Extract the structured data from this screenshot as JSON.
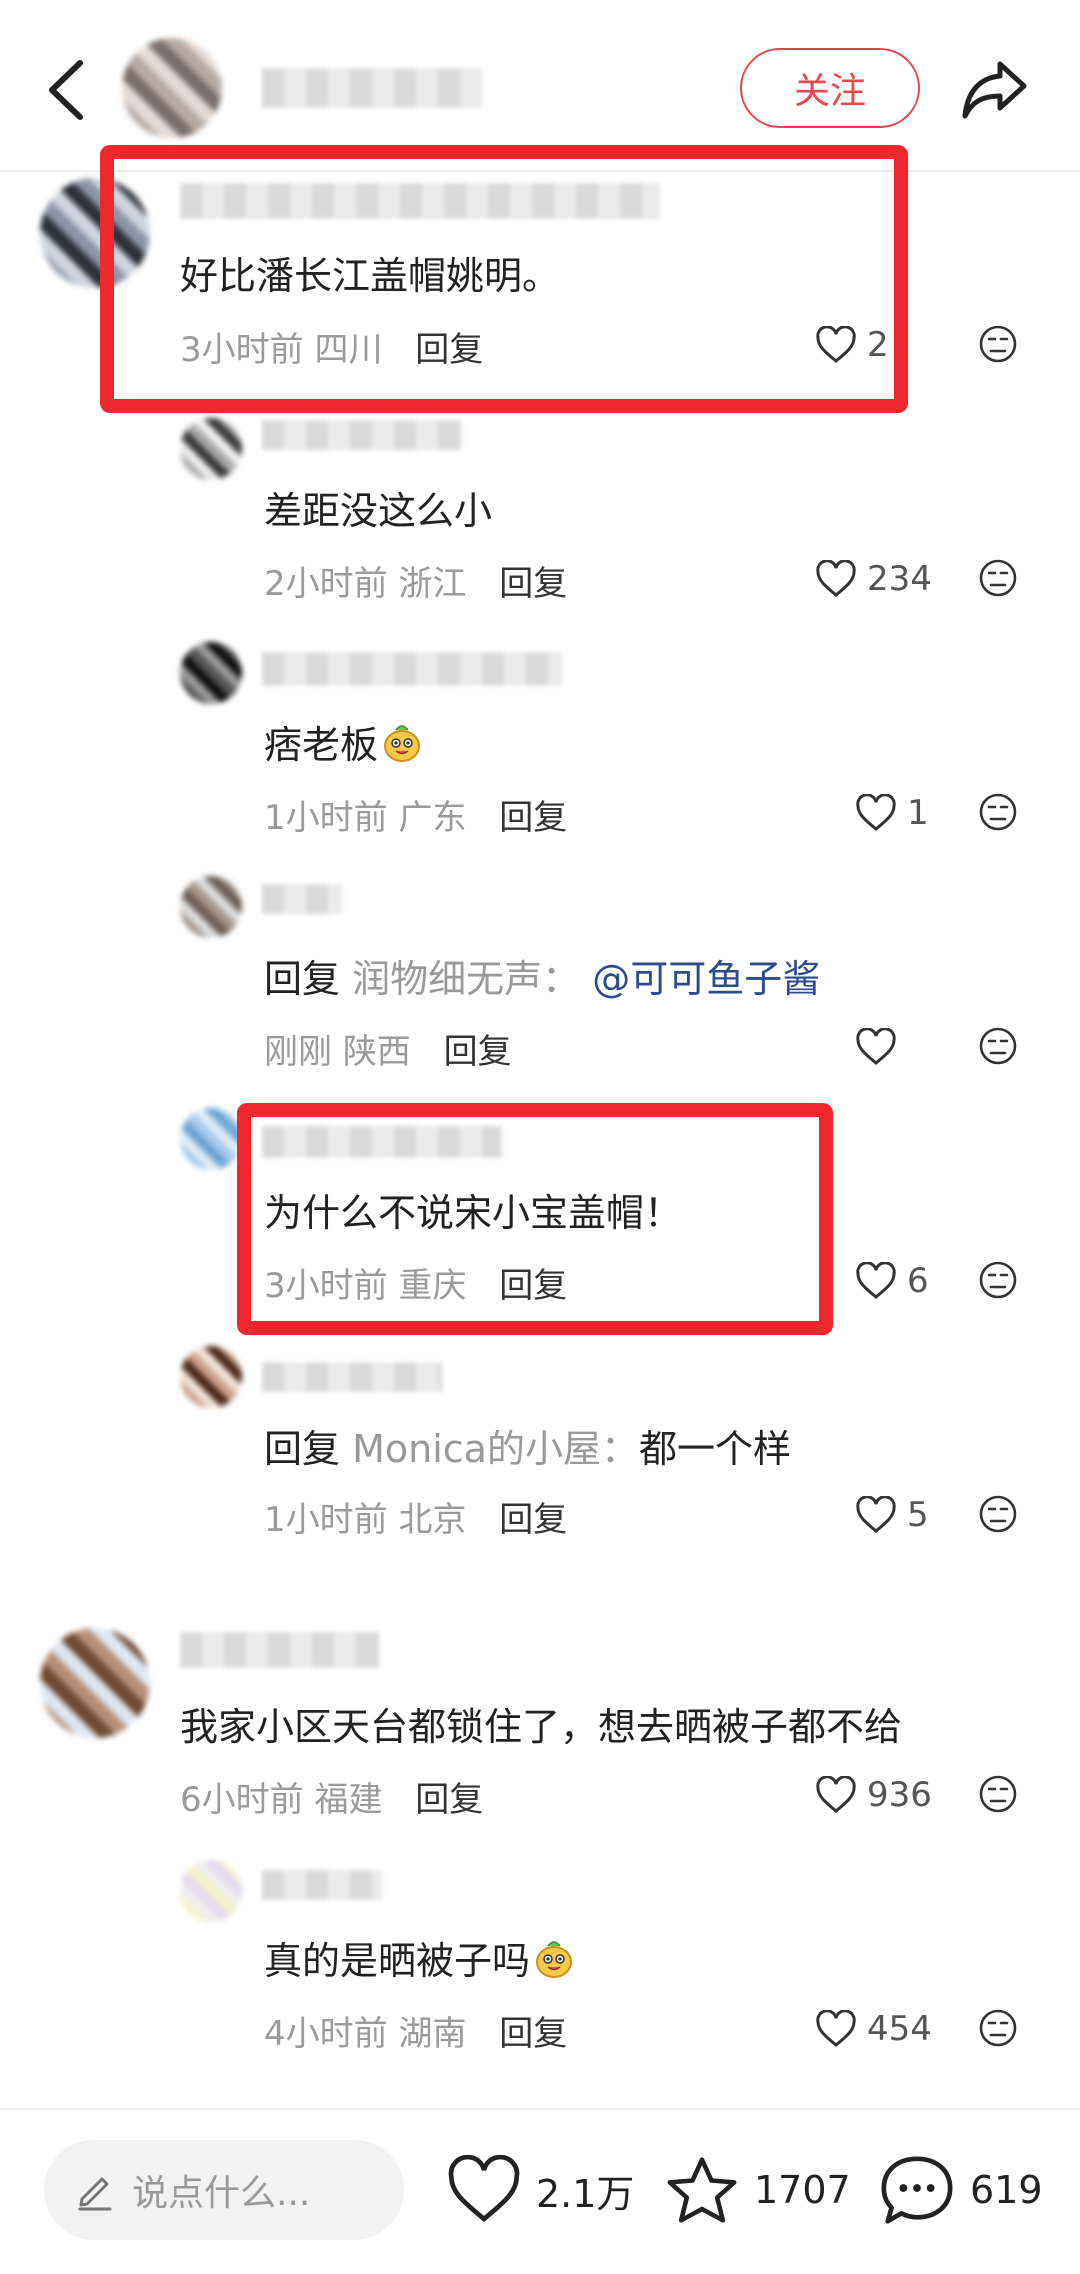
{
  "header": {
    "follow_label": "关注"
  },
  "comments": [
    {
      "text": "好比潘长江盖帽姚明。",
      "time": "3小时前",
      "location": "四川",
      "reply": "回复",
      "likes": "2"
    },
    {
      "text": "差距没这么小",
      "time": "2小时前",
      "location": "浙江",
      "reply": "回复",
      "likes": "234"
    },
    {
      "text": "痞老板",
      "time": "1小时前",
      "location": "广东",
      "reply": "回复",
      "likes": "1"
    },
    {
      "prefix": "回复",
      "reply_to": "润物细无声：",
      "mention": "@可可鱼子酱",
      "time": "刚刚",
      "location": "陕西",
      "reply": "回复",
      "likes": ""
    },
    {
      "text": "为什么不说宋小宝盖帽！",
      "time": "3小时前",
      "location": "重庆",
      "reply": "回复",
      "likes": "6"
    },
    {
      "prefix": "回复",
      "reply_to": "Monica的小屋：",
      "body": "都一个样",
      "time": "1小时前",
      "location": "北京",
      "reply": "回复",
      "likes": "5"
    },
    {
      "text": "我家小区天台都锁住了，想去晒被子都不给",
      "time": "6小时前",
      "location": "福建",
      "reply": "回复",
      "likes": "936"
    },
    {
      "text": "真的是晒被子吗",
      "time": "4小时前",
      "location": "湖南",
      "reply": "回复",
      "likes": "454"
    }
  ],
  "bottom": {
    "input_placeholder": "说点什么...",
    "likes": "2.1万",
    "favorites": "1707",
    "comments": "619"
  },
  "colors": {
    "accent": "#e5484d",
    "highlight_box": "#f0282d",
    "mention": "#2d4b8e"
  }
}
